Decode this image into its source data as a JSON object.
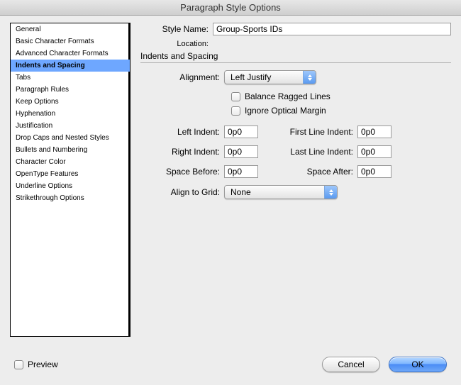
{
  "window": {
    "title": "Paragraph Style Options"
  },
  "header": {
    "style_name_label": "Style Name:",
    "style_name_value": "Group-Sports IDs",
    "location_label": "Location:",
    "section_title": "Indents and Spacing"
  },
  "sidebar": {
    "items": [
      "General",
      "Basic Character Formats",
      "Advanced Character Formats",
      "Indents and Spacing",
      "Tabs",
      "Paragraph Rules",
      "Keep Options",
      "Hyphenation",
      "Justification",
      "Drop Caps and Nested Styles",
      "Bullets and Numbering",
      "Character Color",
      "OpenType Features",
      "Underline Options",
      "Strikethrough Options"
    ],
    "selected_index": 3
  },
  "form": {
    "alignment_label": "Alignment:",
    "alignment_value": "Left Justify",
    "balance_label": "Balance Ragged Lines",
    "ignore_label": "Ignore Optical Margin",
    "left_indent_label": "Left Indent:",
    "left_indent_value": "0p0",
    "first_line_label": "First Line Indent:",
    "first_line_value": "0p0",
    "right_indent_label": "Right Indent:",
    "right_indent_value": "0p0",
    "last_line_label": "Last Line Indent:",
    "last_line_value": "0p0",
    "space_before_label": "Space Before:",
    "space_before_value": "0p0",
    "space_after_label": "Space After:",
    "space_after_value": "0p0",
    "align_grid_label": "Align to Grid:",
    "align_grid_value": "None"
  },
  "footer": {
    "preview_label": "Preview",
    "cancel_label": "Cancel",
    "ok_label": "OK"
  }
}
